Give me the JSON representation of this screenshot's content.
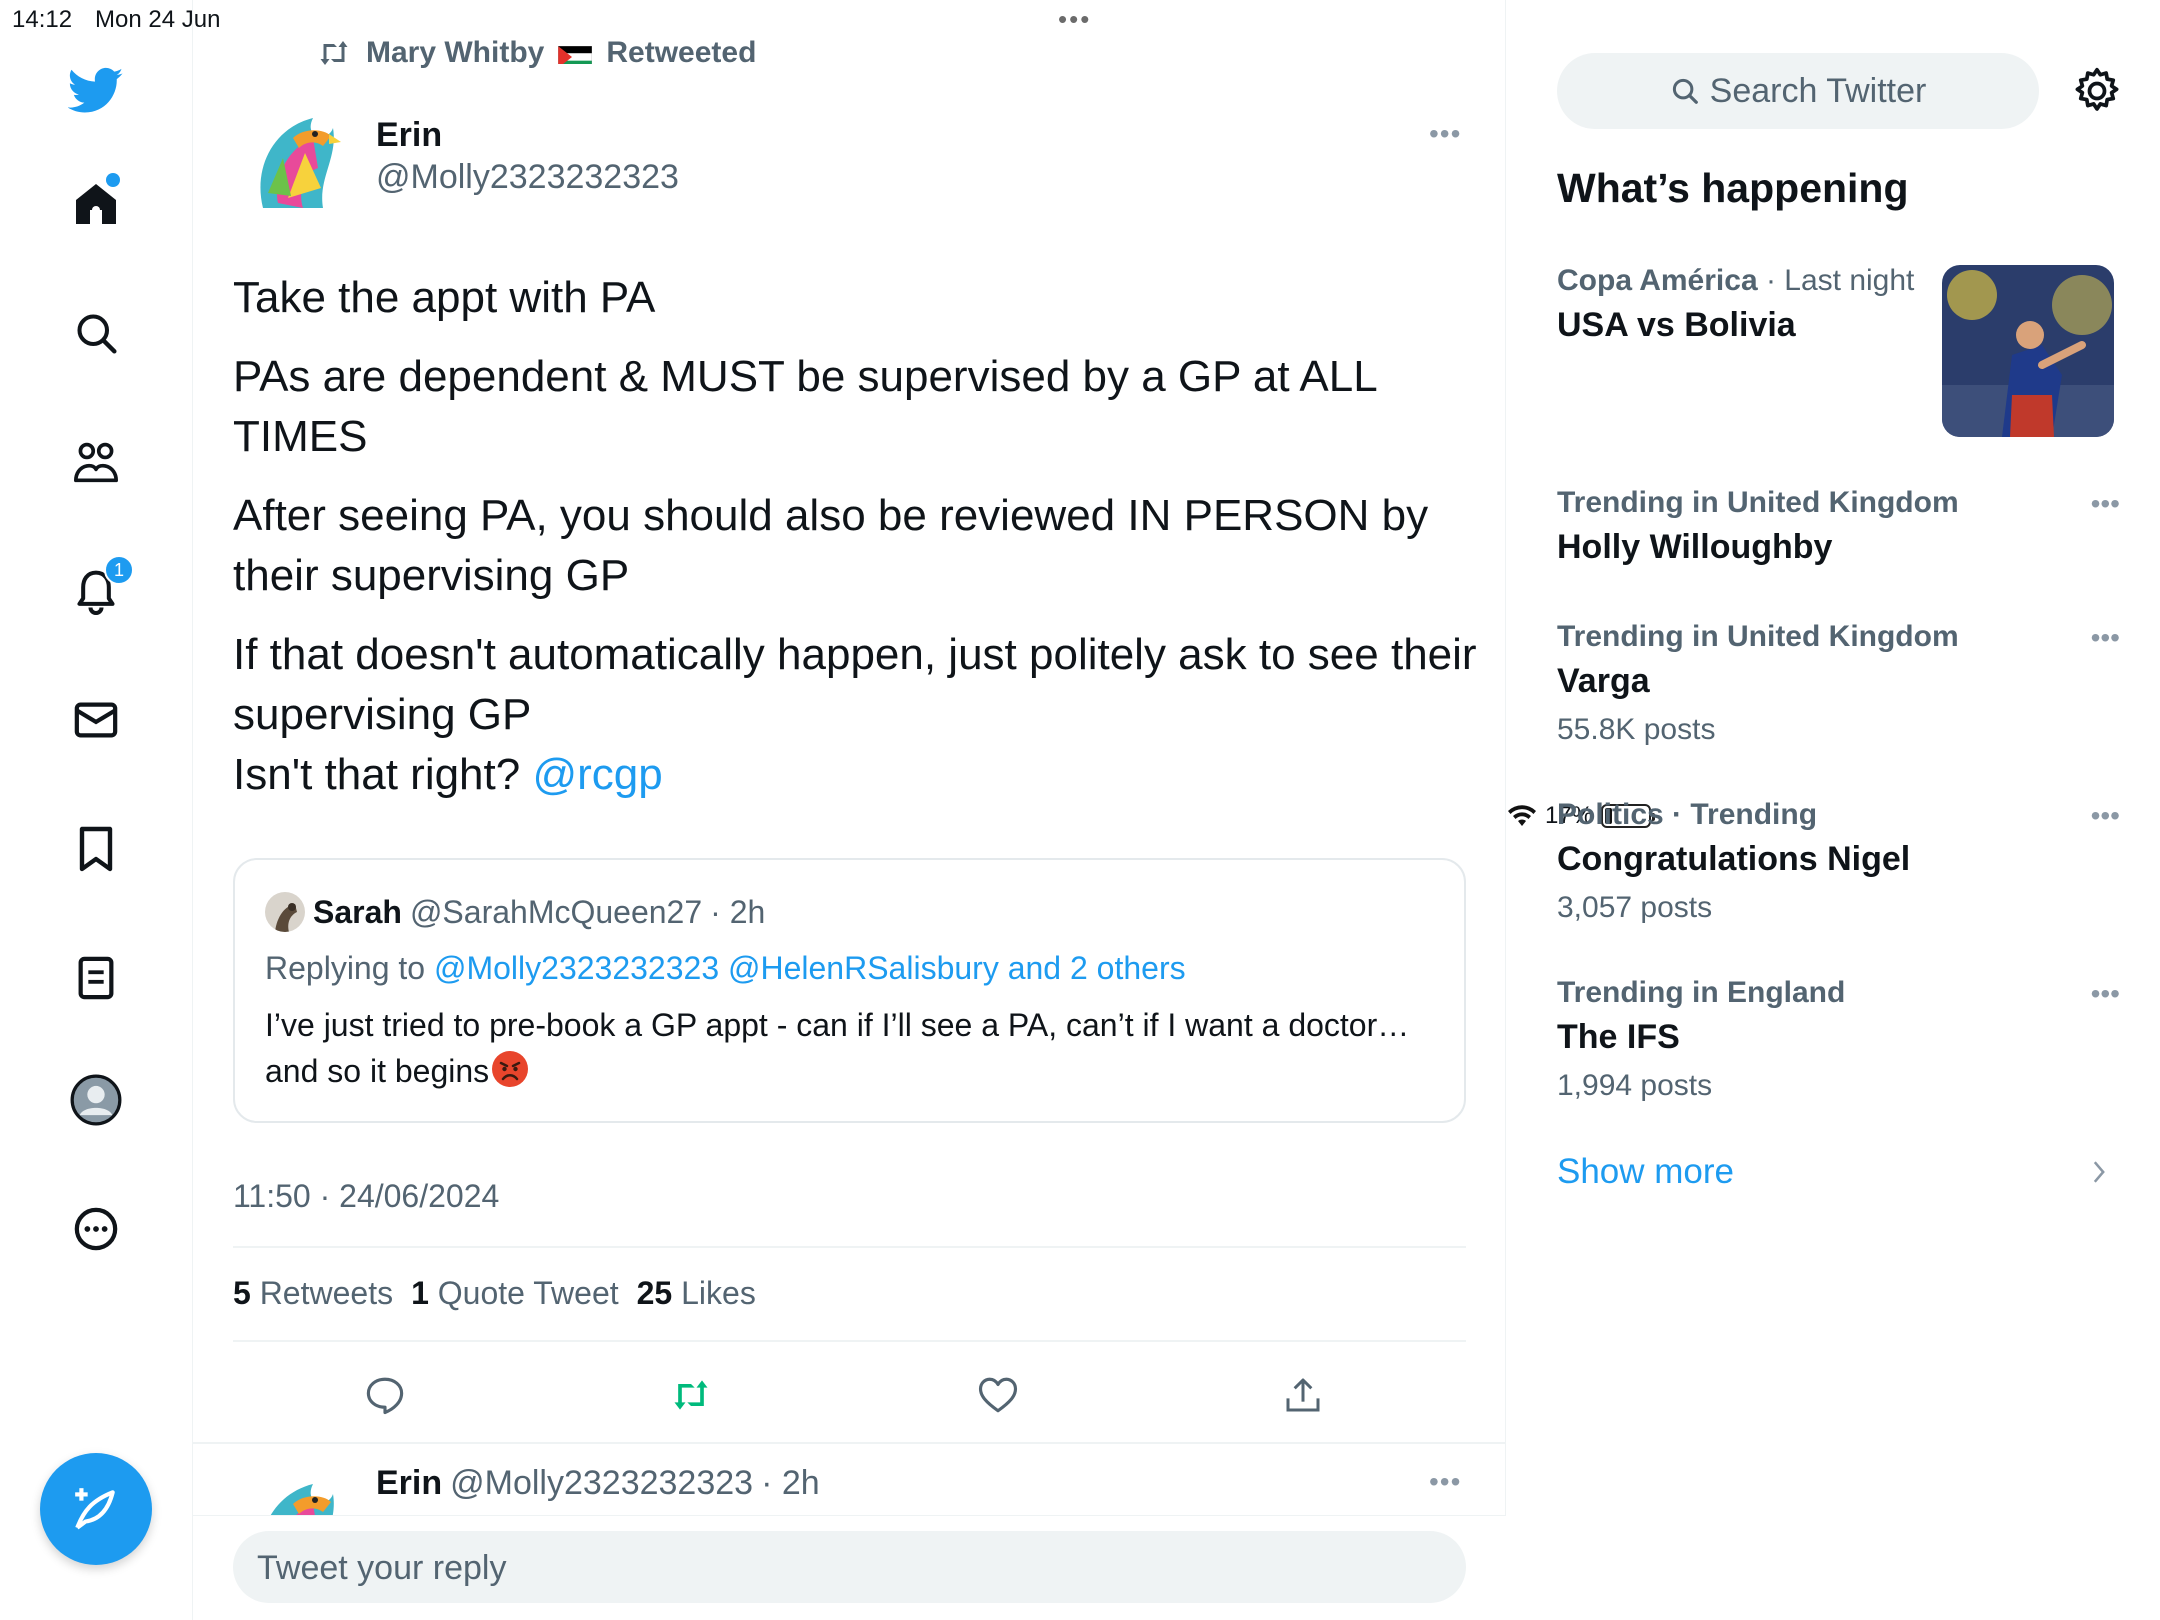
{
  "status_bar": {
    "time": "14:12",
    "date": "Mon 24 Jun",
    "battery": "17%",
    "battery_level": 0.17
  },
  "nav": {
    "notifications_badge": "1",
    "items": [
      "home-icon",
      "search-icon",
      "communities-icon",
      "notifications-icon",
      "messages-icon",
      "bookmarks-icon",
      "lists-icon",
      "profile-icon",
      "more-icon"
    ]
  },
  "retweet_header": {
    "name": "Mary Whitby",
    "label": "Retweeted"
  },
  "tweet": {
    "author_name": "Erin",
    "author_handle": "@Molly2323232323",
    "paragraphs": [
      "Take the appt with PA",
      "PAs are dependent & MUST be supervised by a GP at ALL TIMES",
      "After seeing PA, you should also be reviewed IN PERSON by their supervising GP",
      "If that doesn't automatically happen, just politely ask to see their supervising GP"
    ],
    "last_line": "Isn't that right?",
    "mention": "@rcgp",
    "timestamp": "11:50 · 24/06/2024",
    "retweets_count": "5",
    "retweets_label": "Retweets",
    "quotes_count": "1",
    "quotes_label": "Quote Tweet",
    "likes_count": "25",
    "likes_label": "Likes"
  },
  "quote": {
    "name": "Sarah",
    "handle": "@SarahMcQueen27",
    "time": "· 2h",
    "replying_label": "Replying to",
    "replying_targets": "@Molly2323232323 @HelenRSalisbury and 2 others",
    "text": "I’ve just tried to pre-book a GP appt - can if I’ll see a PA, can’t if I want a doctor… and so it begins"
  },
  "reply_preview": {
    "name": "Erin",
    "handle": "@Molly2323232323",
    "time": "· 2h"
  },
  "reply_box": {
    "placeholder": "Tweet your reply"
  },
  "sidebar": {
    "search_placeholder": "Search Twitter",
    "heading": "What’s happening",
    "trends": [
      {
        "category": "Copa América",
        "suffix": "· Last night",
        "title": "USA vs Bolivia",
        "count": ""
      },
      {
        "category": "Trending in United Kingdom",
        "suffix": "",
        "title": "Holly Willoughby",
        "count": ""
      },
      {
        "category": "Trending in United Kingdom",
        "suffix": "",
        "title": "Varga",
        "count": "55.8K posts"
      },
      {
        "category": "Politics · Trending",
        "suffix": "",
        "title": "Congratulations Nigel",
        "count": "3,057 posts"
      },
      {
        "category": "Trending in England",
        "suffix": "",
        "title": "The IFS",
        "count": "1,994 posts"
      }
    ],
    "show_more": "Show more"
  },
  "colors": {
    "accent": "#1d9bf0",
    "retweet_green": "#00ba7c",
    "secondary_text": "#536471"
  }
}
